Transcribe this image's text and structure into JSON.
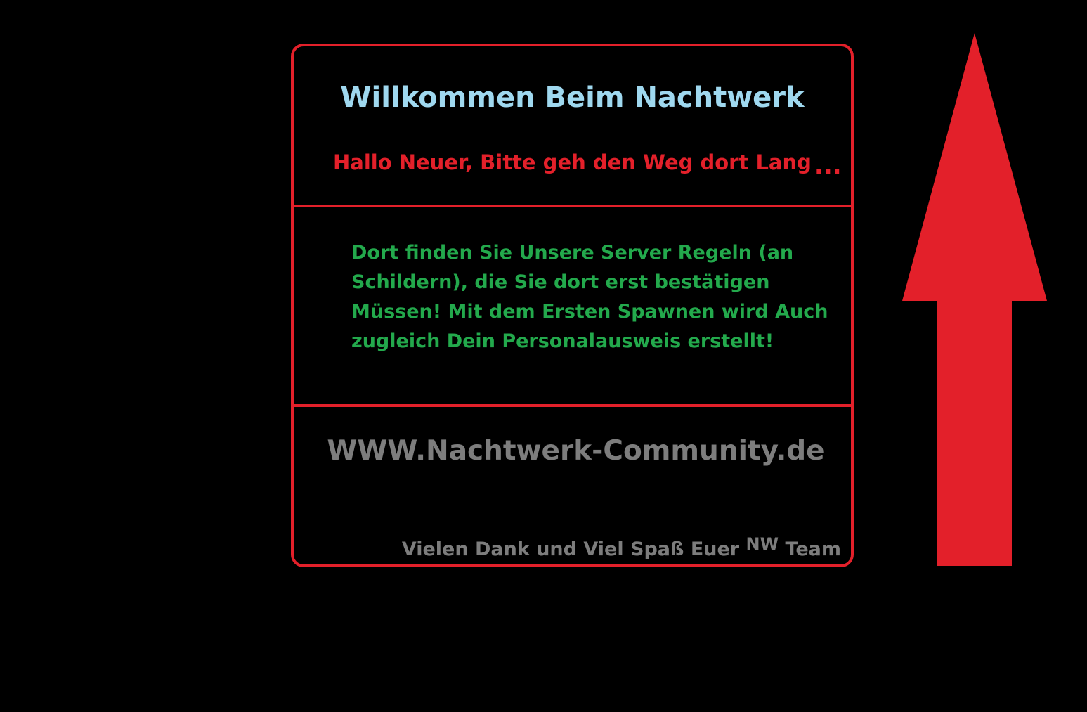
{
  "panel": {
    "title": "Willkommen Beim Nachtwerk",
    "greeting": "Hallo Neuer,  Bitte geh den Weg dort Lang",
    "greeting_dots": "...",
    "rules_text": "Dort finden Sie Unsere Server Regeln (an Schildern), die Sie dort erst bestätigen Müssen! Mit dem Ersten Spawnen wird Auch zugleich Dein Personalausweis erstellt!",
    "website": "WWW.Nachtwerk-Community.de",
    "thanks_before": "Vielen Dank und Viel Spaß Euer",
    "thanks_sup": "NW",
    "thanks_after": "Team"
  },
  "colors": {
    "background": "#000000",
    "accent_red": "#e3202a",
    "title_blue": "#9fd8ef",
    "text_green": "#23a94c",
    "text_gray": "#7d7d7d"
  },
  "icons": {
    "arrow": "up-arrow-icon"
  }
}
